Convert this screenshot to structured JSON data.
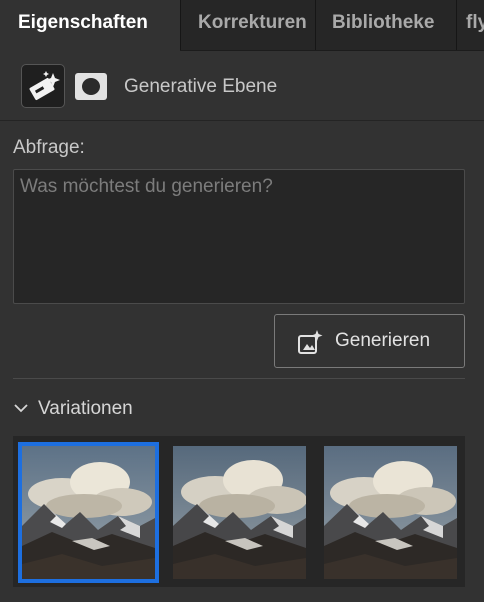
{
  "tabs": [
    {
      "label": "Eigenschaften",
      "active": true
    },
    {
      "label": "Korrekturen",
      "active": false
    },
    {
      "label": "Bibliotheke",
      "active": false
    },
    {
      "label": "fly",
      "active": false
    }
  ],
  "layer": {
    "name": "Generative Ebene",
    "layer_icon": "generative-sparkle-icon",
    "mask_icon": "layer-mask-icon"
  },
  "prompt": {
    "label": "Abfrage:",
    "value": "",
    "placeholder": "Was möchtest du generieren?"
  },
  "generate_button": {
    "label": "Generieren",
    "icon": "generate-sparkle-icon"
  },
  "variations": {
    "title": "Variationen",
    "expanded": true,
    "items": [
      {
        "selected": true
      },
      {
        "selected": false
      },
      {
        "selected": false
      }
    ]
  },
  "colors": {
    "panel_bg": "#323232",
    "tab_bar_bg": "#262626",
    "selection_accent": "#1d6fe0"
  }
}
